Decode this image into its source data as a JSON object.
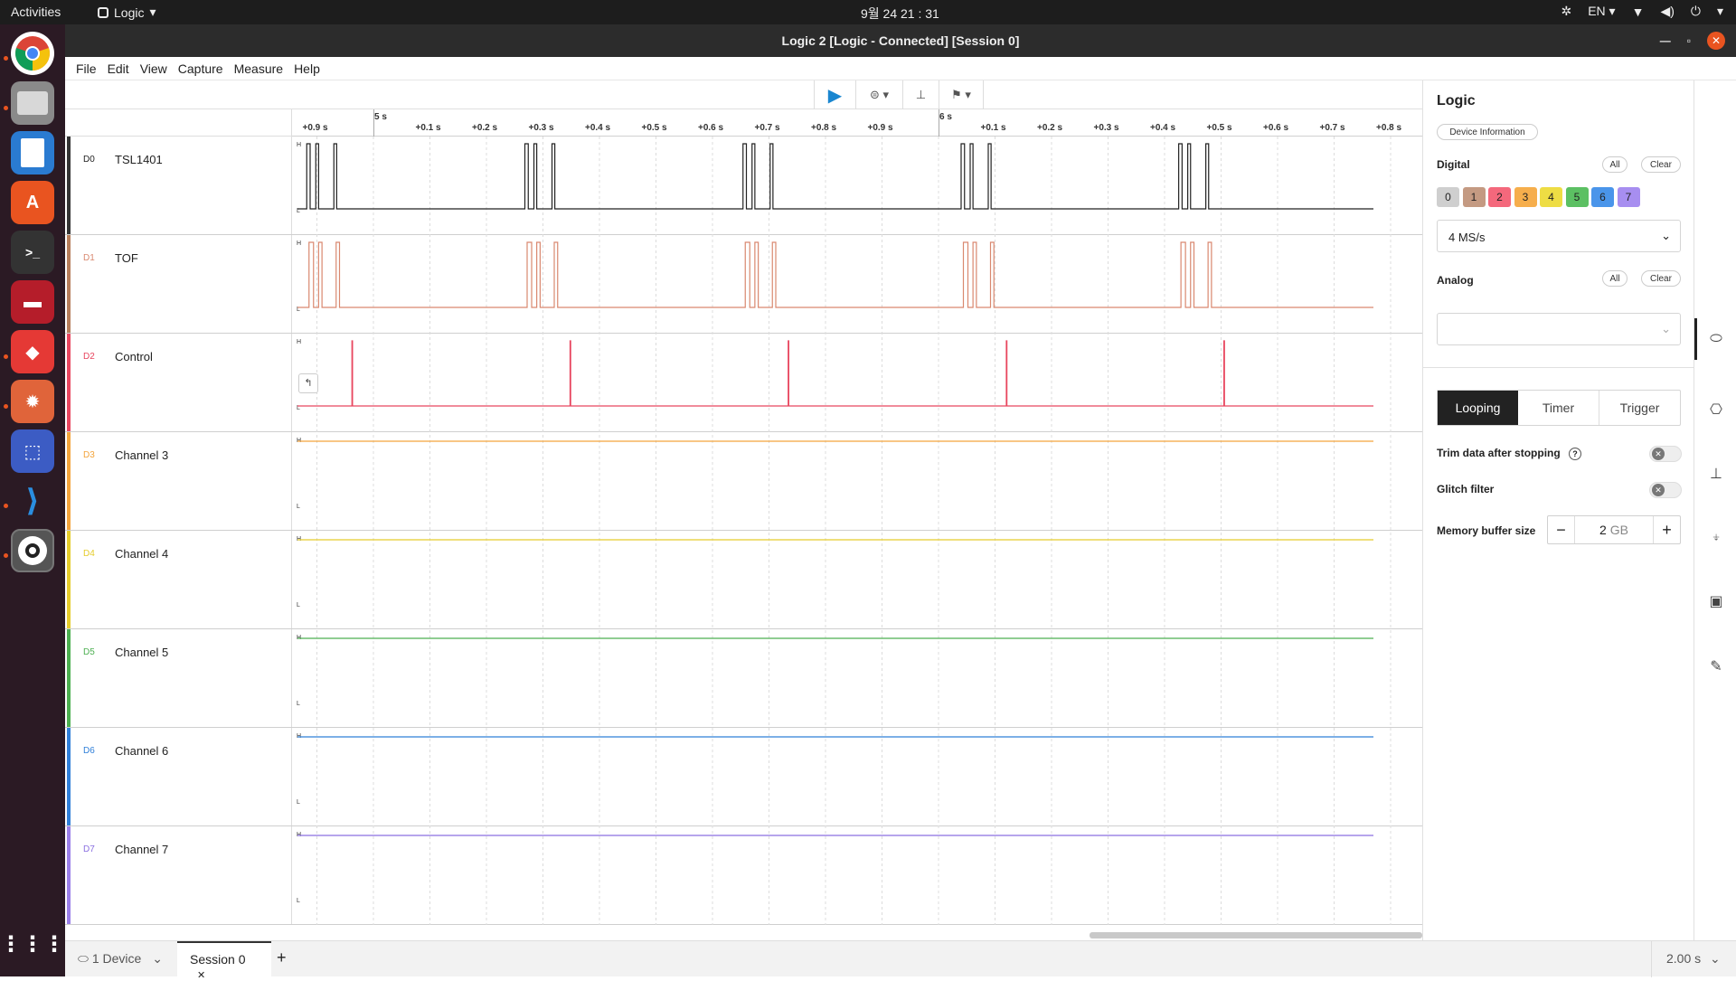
{
  "topbar": {
    "activities": "Activities",
    "app": "Logic",
    "clock": "9월 24 21 : 31",
    "lang": "EN"
  },
  "dock": {
    "items": [
      "chrome",
      "files",
      "writer",
      "software",
      "terminal",
      "app-red",
      "app-diamond",
      "app-burst",
      "screenshot",
      "vscode",
      "logic"
    ]
  },
  "window": {
    "title": "Logic 2 [Logic - Connected] [Session 0]"
  },
  "menu": [
    "File",
    "Edit",
    "View",
    "Capture",
    "Measure",
    "Help"
  ],
  "ruler": {
    "major": [
      {
        "label": "5 s",
        "t": 0
      },
      {
        "label": "6 s",
        "t": 1.0
      }
    ],
    "minor": [
      {
        "label": "+0.9 s",
        "t": -0.1
      },
      {
        "label": "+0.1 s",
        "t": 0.1
      },
      {
        "label": "+0.2 s",
        "t": 0.2
      },
      {
        "label": "+0.3 s",
        "t": 0.3
      },
      {
        "label": "+0.4 s",
        "t": 0.4
      },
      {
        "label": "+0.5 s",
        "t": 0.5
      },
      {
        "label": "+0.6 s",
        "t": 0.6
      },
      {
        "label": "+0.7 s",
        "t": 0.7
      },
      {
        "label": "+0.8 s",
        "t": 0.8
      },
      {
        "label": "+0.9 s",
        "t": 0.9
      },
      {
        "label": "+0.1 s",
        "t": 1.1
      },
      {
        "label": "+0.2 s",
        "t": 1.2
      },
      {
        "label": "+0.3 s",
        "t": 1.3
      },
      {
        "label": "+0.4 s",
        "t": 1.4
      },
      {
        "label": "+0.5 s",
        "t": 1.5
      },
      {
        "label": "+0.6 s",
        "t": 1.6
      },
      {
        "label": "+0.7 s",
        "t": 1.7
      },
      {
        "label": "+0.8 s",
        "t": 1.8
      }
    ]
  },
  "channels": [
    {
      "code": "D0",
      "name": "TSL1401",
      "color": "#222222",
      "bar": "#333333"
    },
    {
      "code": "D1",
      "name": "TOF",
      "color": "#d9886f",
      "bar": "#b57d5a"
    },
    {
      "code": "D2",
      "name": "Control",
      "color": "#e8465f",
      "bar": "#e8465f"
    },
    {
      "code": "D3",
      "name": "Channel 3",
      "color": "#f3a43c",
      "bar": "#f3a43c"
    },
    {
      "code": "D4",
      "name": "Channel 4",
      "color": "#e5cc2c",
      "bar": "#e5cc2c"
    },
    {
      "code": "D5",
      "name": "Channel 5",
      "color": "#4caf50",
      "bar": "#4caf50"
    },
    {
      "code": "D6",
      "name": "Channel 6",
      "color": "#2f7fd8",
      "bar": "#2f7fd8"
    },
    {
      "code": "D7",
      "name": "Channel 7",
      "color": "#8a6fe0",
      "bar": "#9a7fe8"
    }
  ],
  "signals": {
    "burst_starts": [
      -0.118,
      0.268,
      0.654,
      1.04,
      1.425
    ],
    "d0_pulses": [
      [
        0,
        0.006
      ],
      [
        0.016,
        0.021
      ],
      [
        0.048,
        0.053
      ]
    ],
    "d1_pulses": [
      [
        0.004,
        0.012
      ],
      [
        0.021,
        0.027
      ],
      [
        0.052,
        0.058
      ]
    ],
    "d2_pulses": [
      [
        0.08,
        0.081
      ]
    ],
    "levels": {
      "high": "H",
      "low": "L"
    }
  },
  "panel": {
    "title": "Logic",
    "device_info": "Device Information",
    "digital_label": "Digital",
    "all": "All",
    "clear": "Clear",
    "digital_chips": [
      {
        "n": "0",
        "color": "#cfcfcf"
      },
      {
        "n": "1",
        "color": "#c49a82"
      },
      {
        "n": "2",
        "color": "#f4687c"
      },
      {
        "n": "3",
        "color": "#f6ae4c"
      },
      {
        "n": "4",
        "color": "#eedd44"
      },
      {
        "n": "5",
        "color": "#5cc063"
      },
      {
        "n": "6",
        "color": "#4a95ea"
      },
      {
        "n": "7",
        "color": "#a78ef0"
      }
    ],
    "sample_rate": "4 MS/s",
    "analog_label": "Analog",
    "analog_rate": "",
    "tabs": [
      "Looping",
      "Timer",
      "Trigger"
    ],
    "active_tab": "Looping",
    "trim_label": "Trim data after stopping",
    "glitch_label": "Glitch filter",
    "memory_label": "Memory buffer size",
    "memory_value": "2",
    "memory_unit": "GB"
  },
  "bottom": {
    "device": "1 Device",
    "session": "Session 0",
    "duration": "2.00 s"
  }
}
